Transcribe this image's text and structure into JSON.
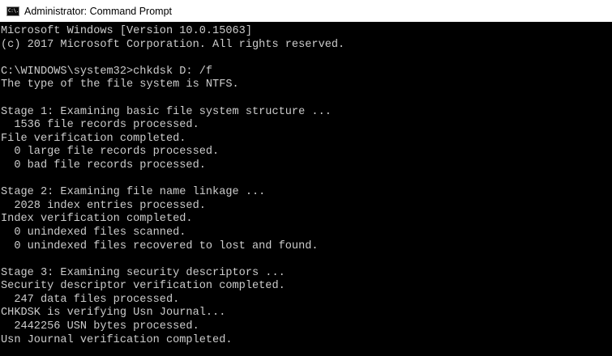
{
  "window": {
    "icon_text": "C:\\.",
    "title": "Administrator: Command Prompt"
  },
  "console": {
    "lines": [
      "Microsoft Windows [Version 10.0.15063]",
      "(c) 2017 Microsoft Corporation. All rights reserved.",
      "",
      "C:\\WINDOWS\\system32>chkdsk D: /f",
      "The type of the file system is NTFS.",
      "",
      "Stage 1: Examining basic file system structure ...",
      "  1536 file records processed.",
      "File verification completed.",
      "  0 large file records processed.",
      "  0 bad file records processed.",
      "",
      "Stage 2: Examining file name linkage ...",
      "  2028 index entries processed.",
      "Index verification completed.",
      "  0 unindexed files scanned.",
      "  0 unindexed files recovered to lost and found.",
      "",
      "Stage 3: Examining security descriptors ...",
      "Security descriptor verification completed.",
      "  247 data files processed.",
      "CHKDSK is verifying Usn Journal...",
      "  2442256 USN bytes processed.",
      "Usn Journal verification completed."
    ]
  },
  "colors": {
    "console_background": "#000000",
    "console_text": "#cccccc",
    "titlebar_background": "#ffffff"
  }
}
